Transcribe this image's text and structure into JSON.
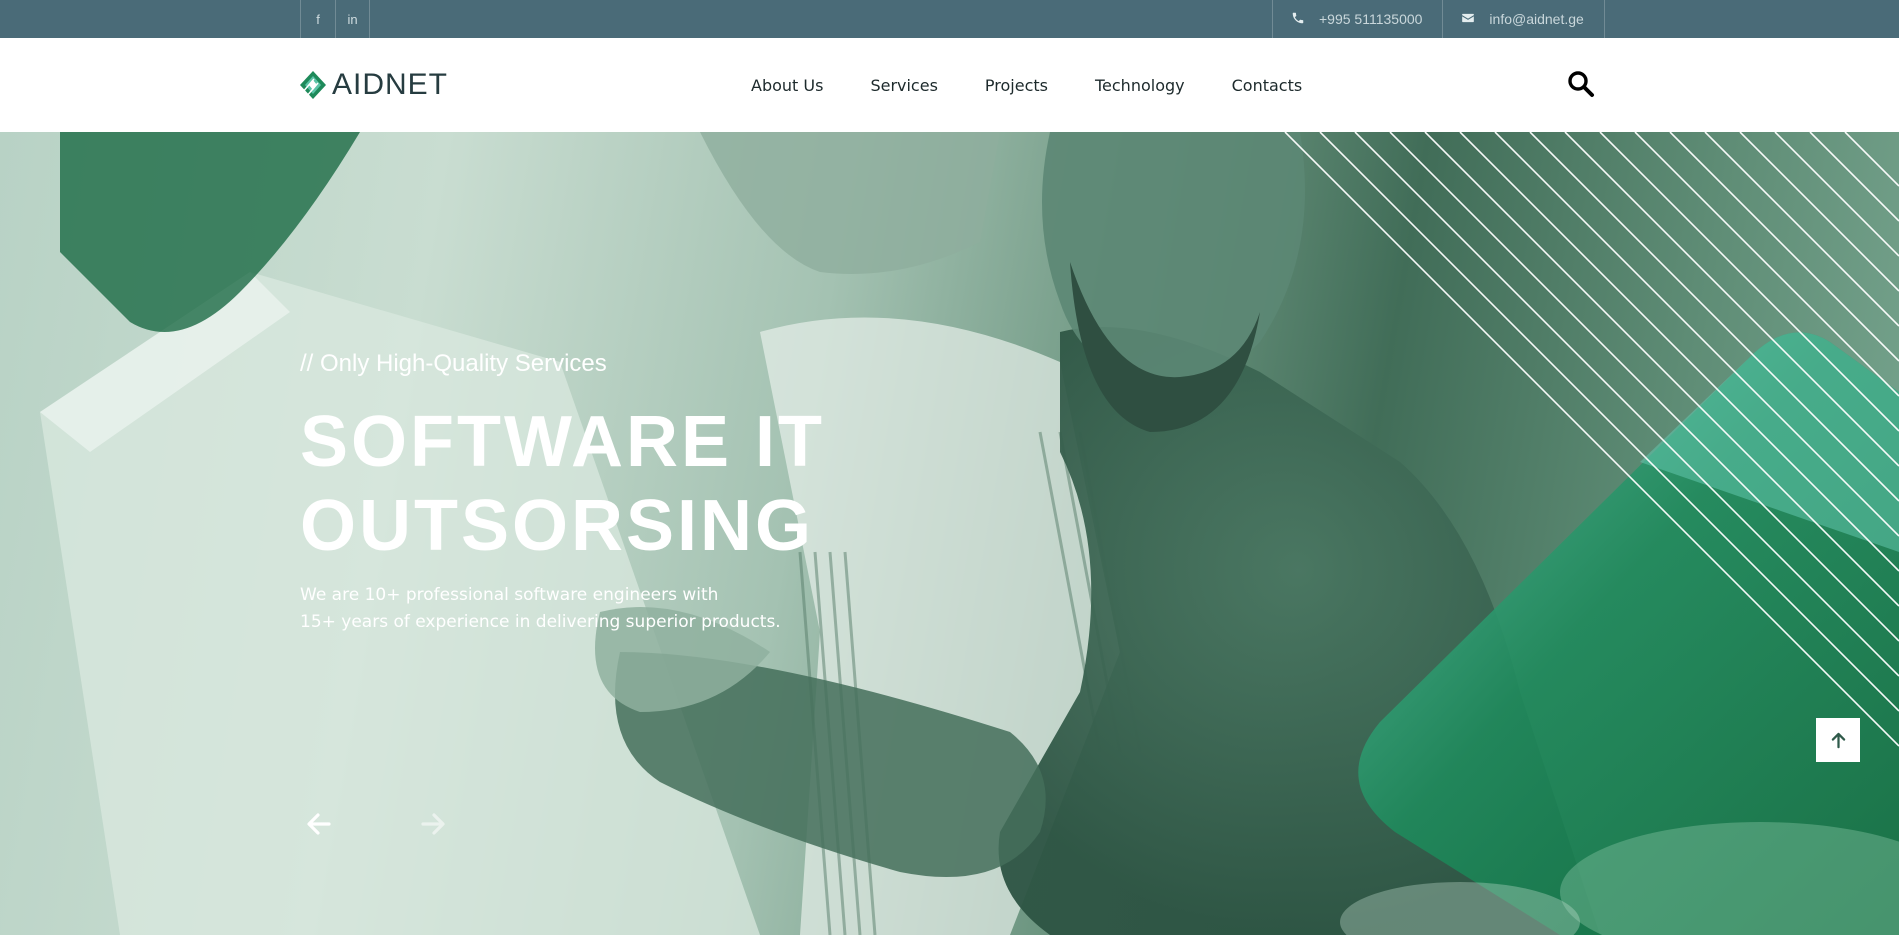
{
  "topbar": {
    "social": [
      {
        "label": "f",
        "icon": "facebook-icon"
      },
      {
        "label": "in",
        "icon": "linkedin-icon"
      }
    ],
    "phone": "+995 511135000",
    "email": "info@aidnet.ge"
  },
  "header": {
    "logo_text": "AIDNET",
    "nav": [
      "About Us",
      "Services",
      "Projects",
      "Technology",
      "Contacts"
    ],
    "search_icon": "search-icon"
  },
  "hero": {
    "tagline": "// Only High-Quality Services",
    "title_line1": "SOFTWARE IT",
    "title_line2": "OUTSORSING",
    "desc_line1": "We are 10+ professional software engineers with",
    "desc_line2": "15+ years of experience in delivering superior products.",
    "prev_icon": "arrow-left-icon",
    "next_icon": "arrow-right-icon"
  },
  "scroll_top_icon": "arrow-up-icon",
  "colors": {
    "topbar": "#4a6b78",
    "accent_green": "#1e8a5a",
    "accent_teal": "#5cc4a8"
  }
}
